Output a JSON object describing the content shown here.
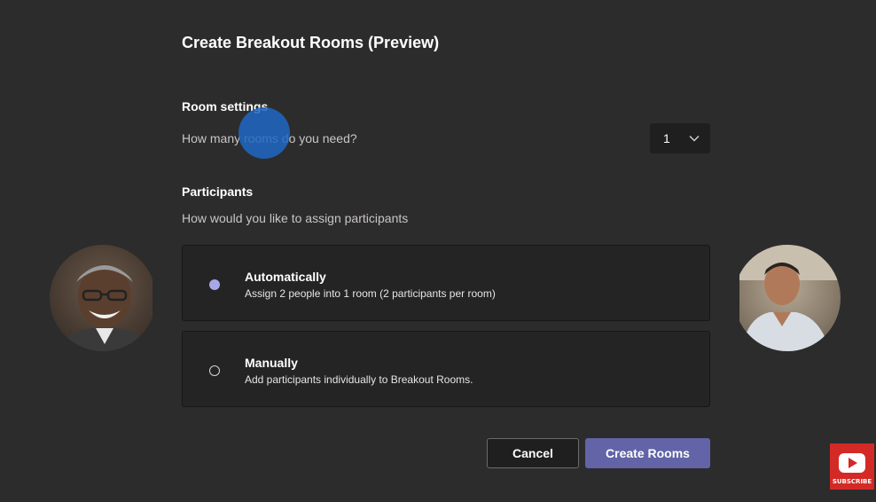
{
  "dialog": {
    "title": "Create Breakout Rooms (Preview)"
  },
  "room_settings": {
    "heading": "Room settings",
    "question": "How many rooms do you need?",
    "rooms_selected": "1"
  },
  "participants": {
    "heading": "Participants",
    "question": "How would you like to assign participants",
    "options": [
      {
        "title": "Automatically",
        "description": "Assign 2 people into 1 room (2 participants per room)",
        "selected": true
      },
      {
        "title": "Manually",
        "description": "Add participants individually to Breakout Rooms.",
        "selected": false
      }
    ]
  },
  "buttons": {
    "cancel_label": "Cancel",
    "create_label": "Create Rooms"
  },
  "overlay": {
    "subscribe_label": "SUBSCRIBE"
  },
  "colors": {
    "accent": "#6264a7",
    "selected_radio": "#a6a8e8",
    "subscribe_red": "#d32a26",
    "cursor_highlight": "#2067c4"
  }
}
